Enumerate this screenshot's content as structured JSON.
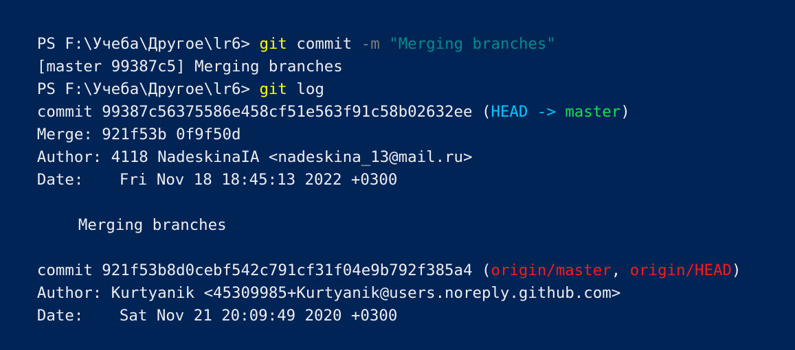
{
  "colors": {
    "background": "#012456",
    "text": "#eeedf0",
    "command": "#ffff00",
    "parameter": "#7d7d7d",
    "string": "#008b8b",
    "head_ref": "#00c8ff",
    "local_branch": "#16e04f",
    "remote_branch": "#ff1a1a"
  },
  "lines": {
    "l1": {
      "prompt": "PS F:\\Учеба\\Другое\\lr6> ",
      "cmd": "git",
      "sp1": " ",
      "sub": "commit",
      "sp2": " ",
      "flag": "-m",
      "sp3": " ",
      "message": "\"Merging branches\""
    },
    "l2": {
      "text": "[master 99387c5] Merging branches"
    },
    "l3": {
      "prompt": "PS F:\\Учеба\\Другое\\lr6> ",
      "cmd": "git",
      "sp1": " ",
      "sub": "log"
    },
    "l4": {
      "label": "commit 99387c56375586e458cf51e563f91c58b02632ee (",
      "head": "HEAD -> ",
      "branch": "master",
      "close": ")"
    },
    "l5": {
      "text": "Merge: 921f53b 0f9f50d"
    },
    "l6": {
      "text": "Author: 4118 NadeskinaIA <nadeskina_13@mail.ru>"
    },
    "l7": {
      "label": "Date:",
      "value": "Fri Nov 18 18:45:13 2022 +0300"
    },
    "l8": {
      "message": "Merging branches"
    },
    "l9": {
      "label": "commit 921f53b8d0cebf542c791cf31f04e9b792f385a4 (",
      "remote1": "origin/master",
      "sep": ", ",
      "remote2": "origin/HEAD",
      "close": ")"
    },
    "l10": {
      "text": "Author: Kurtyanik <45309985+Kurtyanik@users.noreply.github.com>"
    },
    "l11": {
      "label": "Date:",
      "value": "Sat Nov 21 20:09:49 2020 +0300"
    }
  }
}
